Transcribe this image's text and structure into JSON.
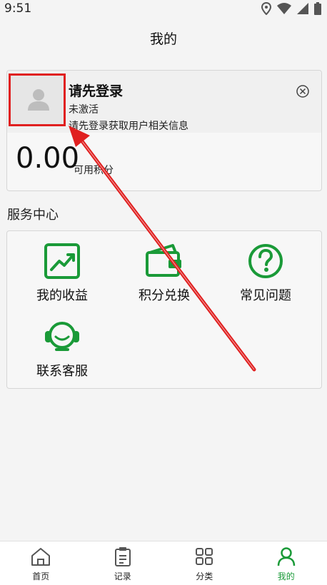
{
  "status_bar": {
    "time": "9:51"
  },
  "header": {
    "title": "我的"
  },
  "user_card": {
    "name": "请先登录",
    "status": "未激活",
    "tip": "请先登录获取用户相关信息",
    "points_value": "0.00",
    "points_label": "可用积分"
  },
  "services": {
    "title": "服务中心",
    "items": [
      {
        "label": "我的收益",
        "icon": "earnings-chart-icon"
      },
      {
        "label": "积分兑换",
        "icon": "wallet-icon"
      },
      {
        "label": "常见问题",
        "icon": "question-icon"
      },
      {
        "label": "联系客服",
        "icon": "customer-service-icon"
      }
    ]
  },
  "tabbar": {
    "items": [
      {
        "label": "首页",
        "icon": "home-icon"
      },
      {
        "label": "记录",
        "icon": "clipboard-icon"
      },
      {
        "label": "分类",
        "icon": "grid-icon"
      },
      {
        "label": "我的",
        "icon": "person-icon",
        "active": true
      }
    ]
  },
  "colors": {
    "accent": "#1a9a38",
    "highlight": "#e02020"
  }
}
